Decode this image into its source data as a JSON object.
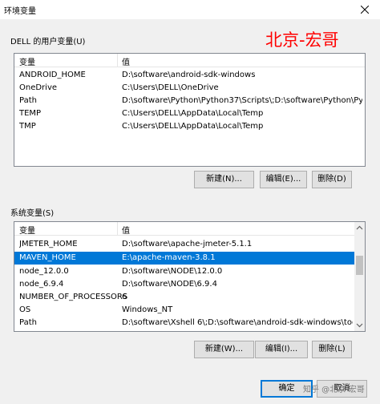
{
  "window": {
    "title": "环境变量"
  },
  "watermark": "北京-宏哥",
  "user_vars": {
    "group_label": "DELL 的用户变量(U)",
    "columns": [
      "变量",
      "值"
    ],
    "rows": [
      {
        "name": "ANDROID_HOME",
        "value": "D:\\software\\android-sdk-windows"
      },
      {
        "name": "OneDrive",
        "value": "C:\\Users\\DELL\\OneDrive"
      },
      {
        "name": "Path",
        "value": "D:\\software\\Python\\Python37\\Scripts\\;D:\\software\\Python\\Pyt..."
      },
      {
        "name": "TEMP",
        "value": "C:\\Users\\DELL\\AppData\\Local\\Temp"
      },
      {
        "name": "TMP",
        "value": "C:\\Users\\DELL\\AppData\\Local\\Temp"
      }
    ],
    "buttons": {
      "new": "新建(N)...",
      "edit": "编辑(E)...",
      "delete": "删除(D)"
    }
  },
  "system_vars": {
    "group_label": "系统变量(S)",
    "columns": [
      "变量",
      "值"
    ],
    "rows": [
      {
        "name": "JMETER_HOME",
        "value": "D:\\software\\apache-jmeter-5.1.1"
      },
      {
        "name": "MAVEN_HOME",
        "value": "E:\\apache-maven-3.8.1"
      },
      {
        "name": "node_12.0.0",
        "value": "D:\\software\\NODE\\12.0.0"
      },
      {
        "name": "node_6.9.4",
        "value": "D:\\software\\NODE\\6.9.4"
      },
      {
        "name": "NUMBER_OF_PROCESSORS",
        "value": "6"
      },
      {
        "name": "OS",
        "value": "Windows_NT"
      },
      {
        "name": "Path",
        "value": "D:\\software\\Xshell 6\\;D:\\software\\android-sdk-windows\\tool..."
      }
    ],
    "selected_index": 1,
    "buttons": {
      "new": "新建(W)...",
      "edit": "编辑(I)...",
      "delete": "删除(L)"
    }
  },
  "footer": {
    "ok": "确定",
    "cancel": "取消"
  },
  "source_watermark": "知乎 @北京-宏哥"
}
